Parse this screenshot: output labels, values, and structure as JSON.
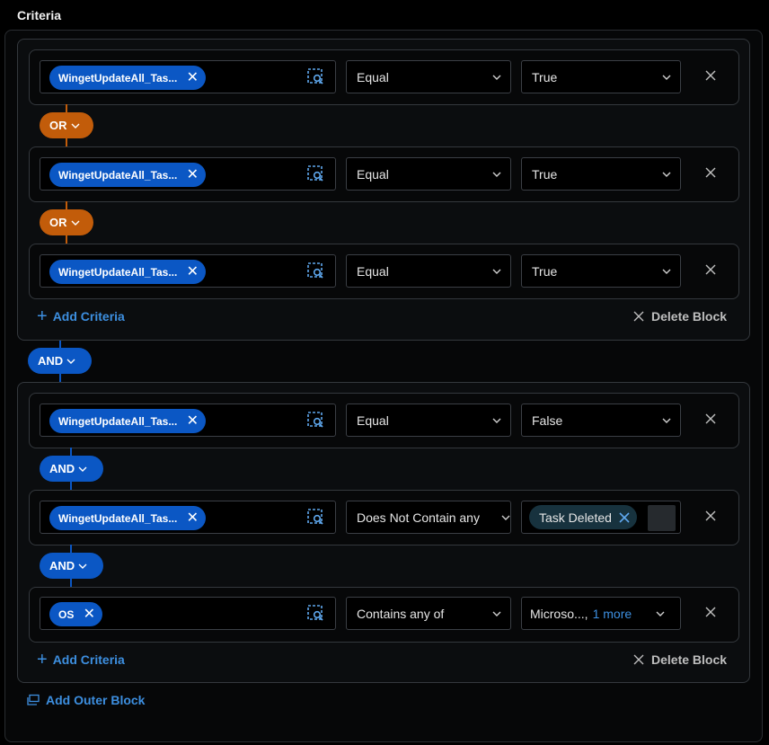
{
  "page_title": "Criteria",
  "colors": {
    "chip": "#0b57c4",
    "or_pill": "#c25c0a",
    "and_pill": "#0b57c4",
    "link": "#3d8fe0"
  },
  "blocks": [
    {
      "rows": [
        {
          "field": "WingetUpdateAll_Tas...",
          "operator": "Equal",
          "value": "True"
        },
        {
          "field": "WingetUpdateAll_Tas...",
          "operator": "Equal",
          "value": "True"
        },
        {
          "field": "WingetUpdateAll_Tas...",
          "operator": "Equal",
          "value": "True"
        }
      ],
      "connectors": [
        "OR",
        "OR"
      ],
      "add_criteria": "Add Criteria",
      "delete_block": "Delete Block"
    },
    {
      "rows": [
        {
          "field": "WingetUpdateAll_Tas...",
          "operator": "Equal",
          "value": "False"
        },
        {
          "field": "WingetUpdateAll_Tas...",
          "operator": "Does Not Contain any",
          "value_tag": "Task Deleted"
        },
        {
          "field": "OS",
          "operator": "Contains any of",
          "value": "Microso...,",
          "value_more": "1 more"
        }
      ],
      "connectors": [
        "AND",
        "AND"
      ],
      "add_criteria": "Add Criteria",
      "delete_block": "Delete Block"
    }
  ],
  "outer_connector": "AND",
  "add_outer_block": "Add Outer Block",
  "icons": {
    "field_picker": "field-picker-icon",
    "remove": "close-icon",
    "dropdown": "chevron-down-icon",
    "add": "plus-icon",
    "outer_block": "outer-block-icon"
  }
}
